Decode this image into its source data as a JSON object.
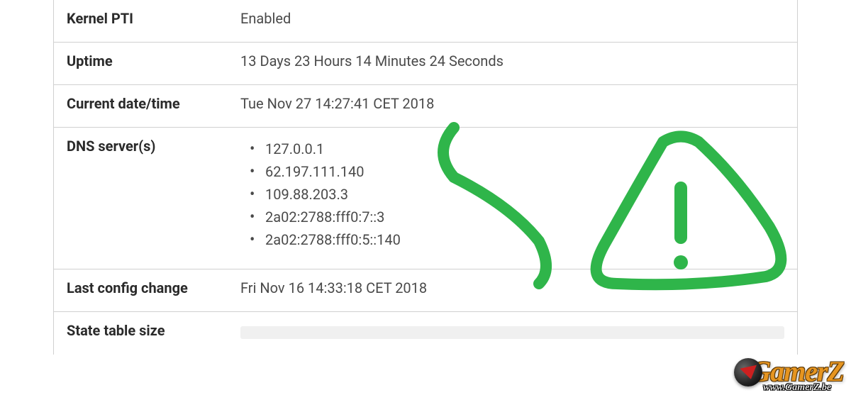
{
  "rows": {
    "kernel_pti": {
      "label": "Kernel PTI",
      "value": "Enabled"
    },
    "uptime": {
      "label": "Uptime",
      "value": "13 Days 23 Hours 14 Minutes 24 Seconds"
    },
    "current_datetime": {
      "label": "Current date/time",
      "value": "Tue Nov 27 14:27:41 CET 2018"
    },
    "dns_servers": {
      "label": "DNS server(s)",
      "items": [
        "127.0.0.1",
        "62.197.111.140",
        "109.88.203.3",
        "2a02:2788:fff0:7::3",
        "2a02:2788:fff0:5::140"
      ]
    },
    "last_config_change": {
      "label": "Last config change",
      "value": "Fri Nov 16 14:33:18 CET 2018"
    },
    "state_table_size": {
      "label": "State table size",
      "value": ""
    }
  },
  "watermark": {
    "brand": "GamerZ",
    "url": "www.GamerZ.be"
  }
}
